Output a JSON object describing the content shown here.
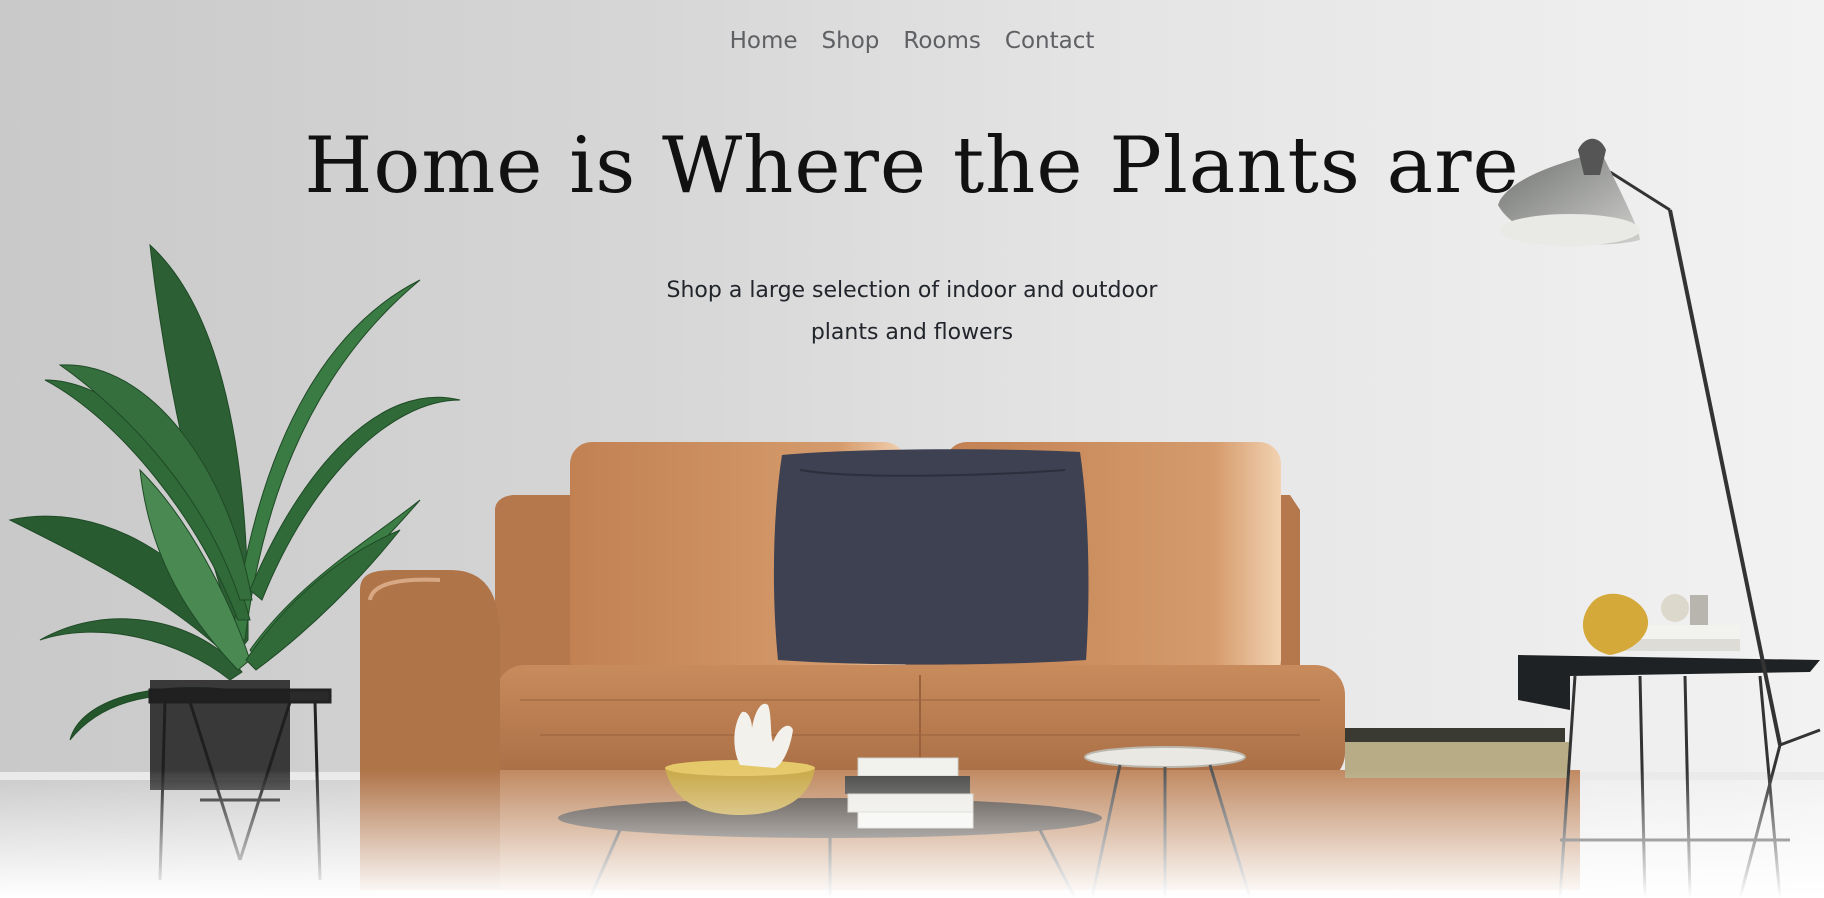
{
  "nav": {
    "items": [
      {
        "label": "Home"
      },
      {
        "label": "Shop"
      },
      {
        "label": "Rooms"
      },
      {
        "label": "Contact"
      }
    ]
  },
  "hero": {
    "title": "Home is Where the Plants are",
    "subtitle": "Shop a large selection of indoor and outdoor plants and flowers",
    "image_icon": "living-room-photo",
    "colors": {
      "title": "#111111",
      "nav_text": "#5e6063",
      "sofa": "#bd8358",
      "pillow": "#3d4152",
      "plant": "#2f6a38"
    }
  }
}
